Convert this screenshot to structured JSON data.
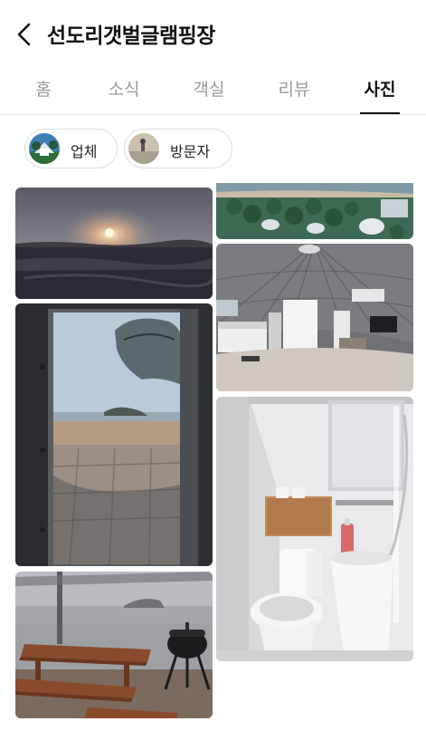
{
  "header": {
    "title": "선도리갯벌글램핑장"
  },
  "tabs": [
    {
      "label": "홈",
      "active": false
    },
    {
      "label": "소식",
      "active": false
    },
    {
      "label": "객실",
      "active": false
    },
    {
      "label": "리뷰",
      "active": false
    },
    {
      "label": "사진",
      "active": true
    }
  ],
  "chips": [
    {
      "label": "업체"
    },
    {
      "label": "방문자"
    }
  ],
  "colors": {
    "active_tab": "#111111",
    "inactive_tab": "#9a9a9a",
    "divider": "#e6e6e6"
  }
}
